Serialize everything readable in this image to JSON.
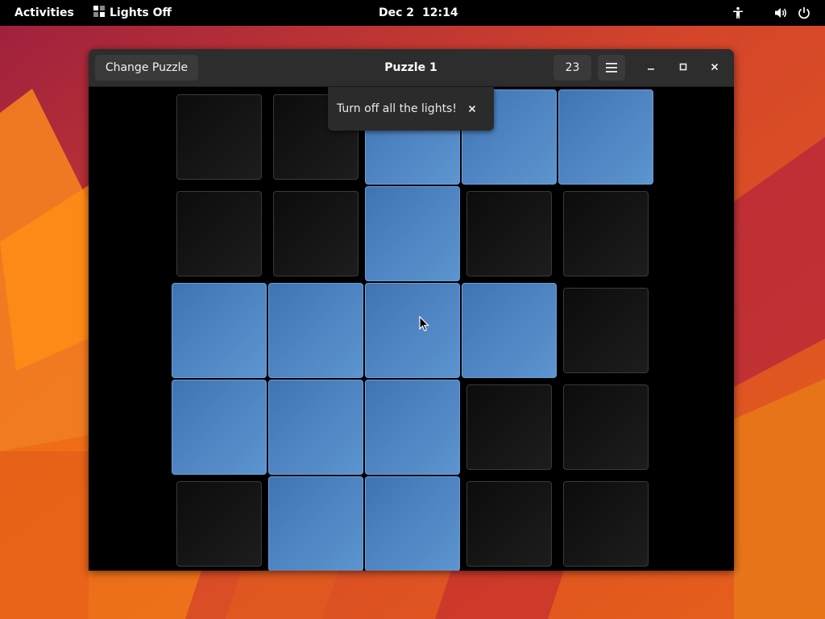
{
  "topbar": {
    "activities": "Activities",
    "app_name": "Lights Off",
    "date": "Dec 2",
    "time": "12:14",
    "icons": [
      "accessibility-icon",
      "volume-icon",
      "power-icon"
    ]
  },
  "window": {
    "change_puzzle_label": "Change Puzzle",
    "title": "Puzzle 1",
    "moves": "23",
    "menu_icon": "hamburger-menu-icon",
    "controls": [
      "minimize-icon",
      "maximize-icon",
      "close-icon"
    ]
  },
  "toast": {
    "message": "Turn off all the lights!",
    "close_icon": "close-icon"
  },
  "board": {
    "rows": 5,
    "cols": 5,
    "lights": [
      [
        false,
        false,
        true,
        true,
        true
      ],
      [
        false,
        false,
        true,
        false,
        false
      ],
      [
        true,
        true,
        true,
        true,
        false
      ],
      [
        true,
        true,
        true,
        false,
        false
      ],
      [
        false,
        true,
        true,
        false,
        false
      ]
    ]
  },
  "colors": {
    "light_on": "#4f86c6",
    "light_off": "#141414",
    "window_bg": "#000000",
    "headerbar": "#2d2d2d"
  }
}
